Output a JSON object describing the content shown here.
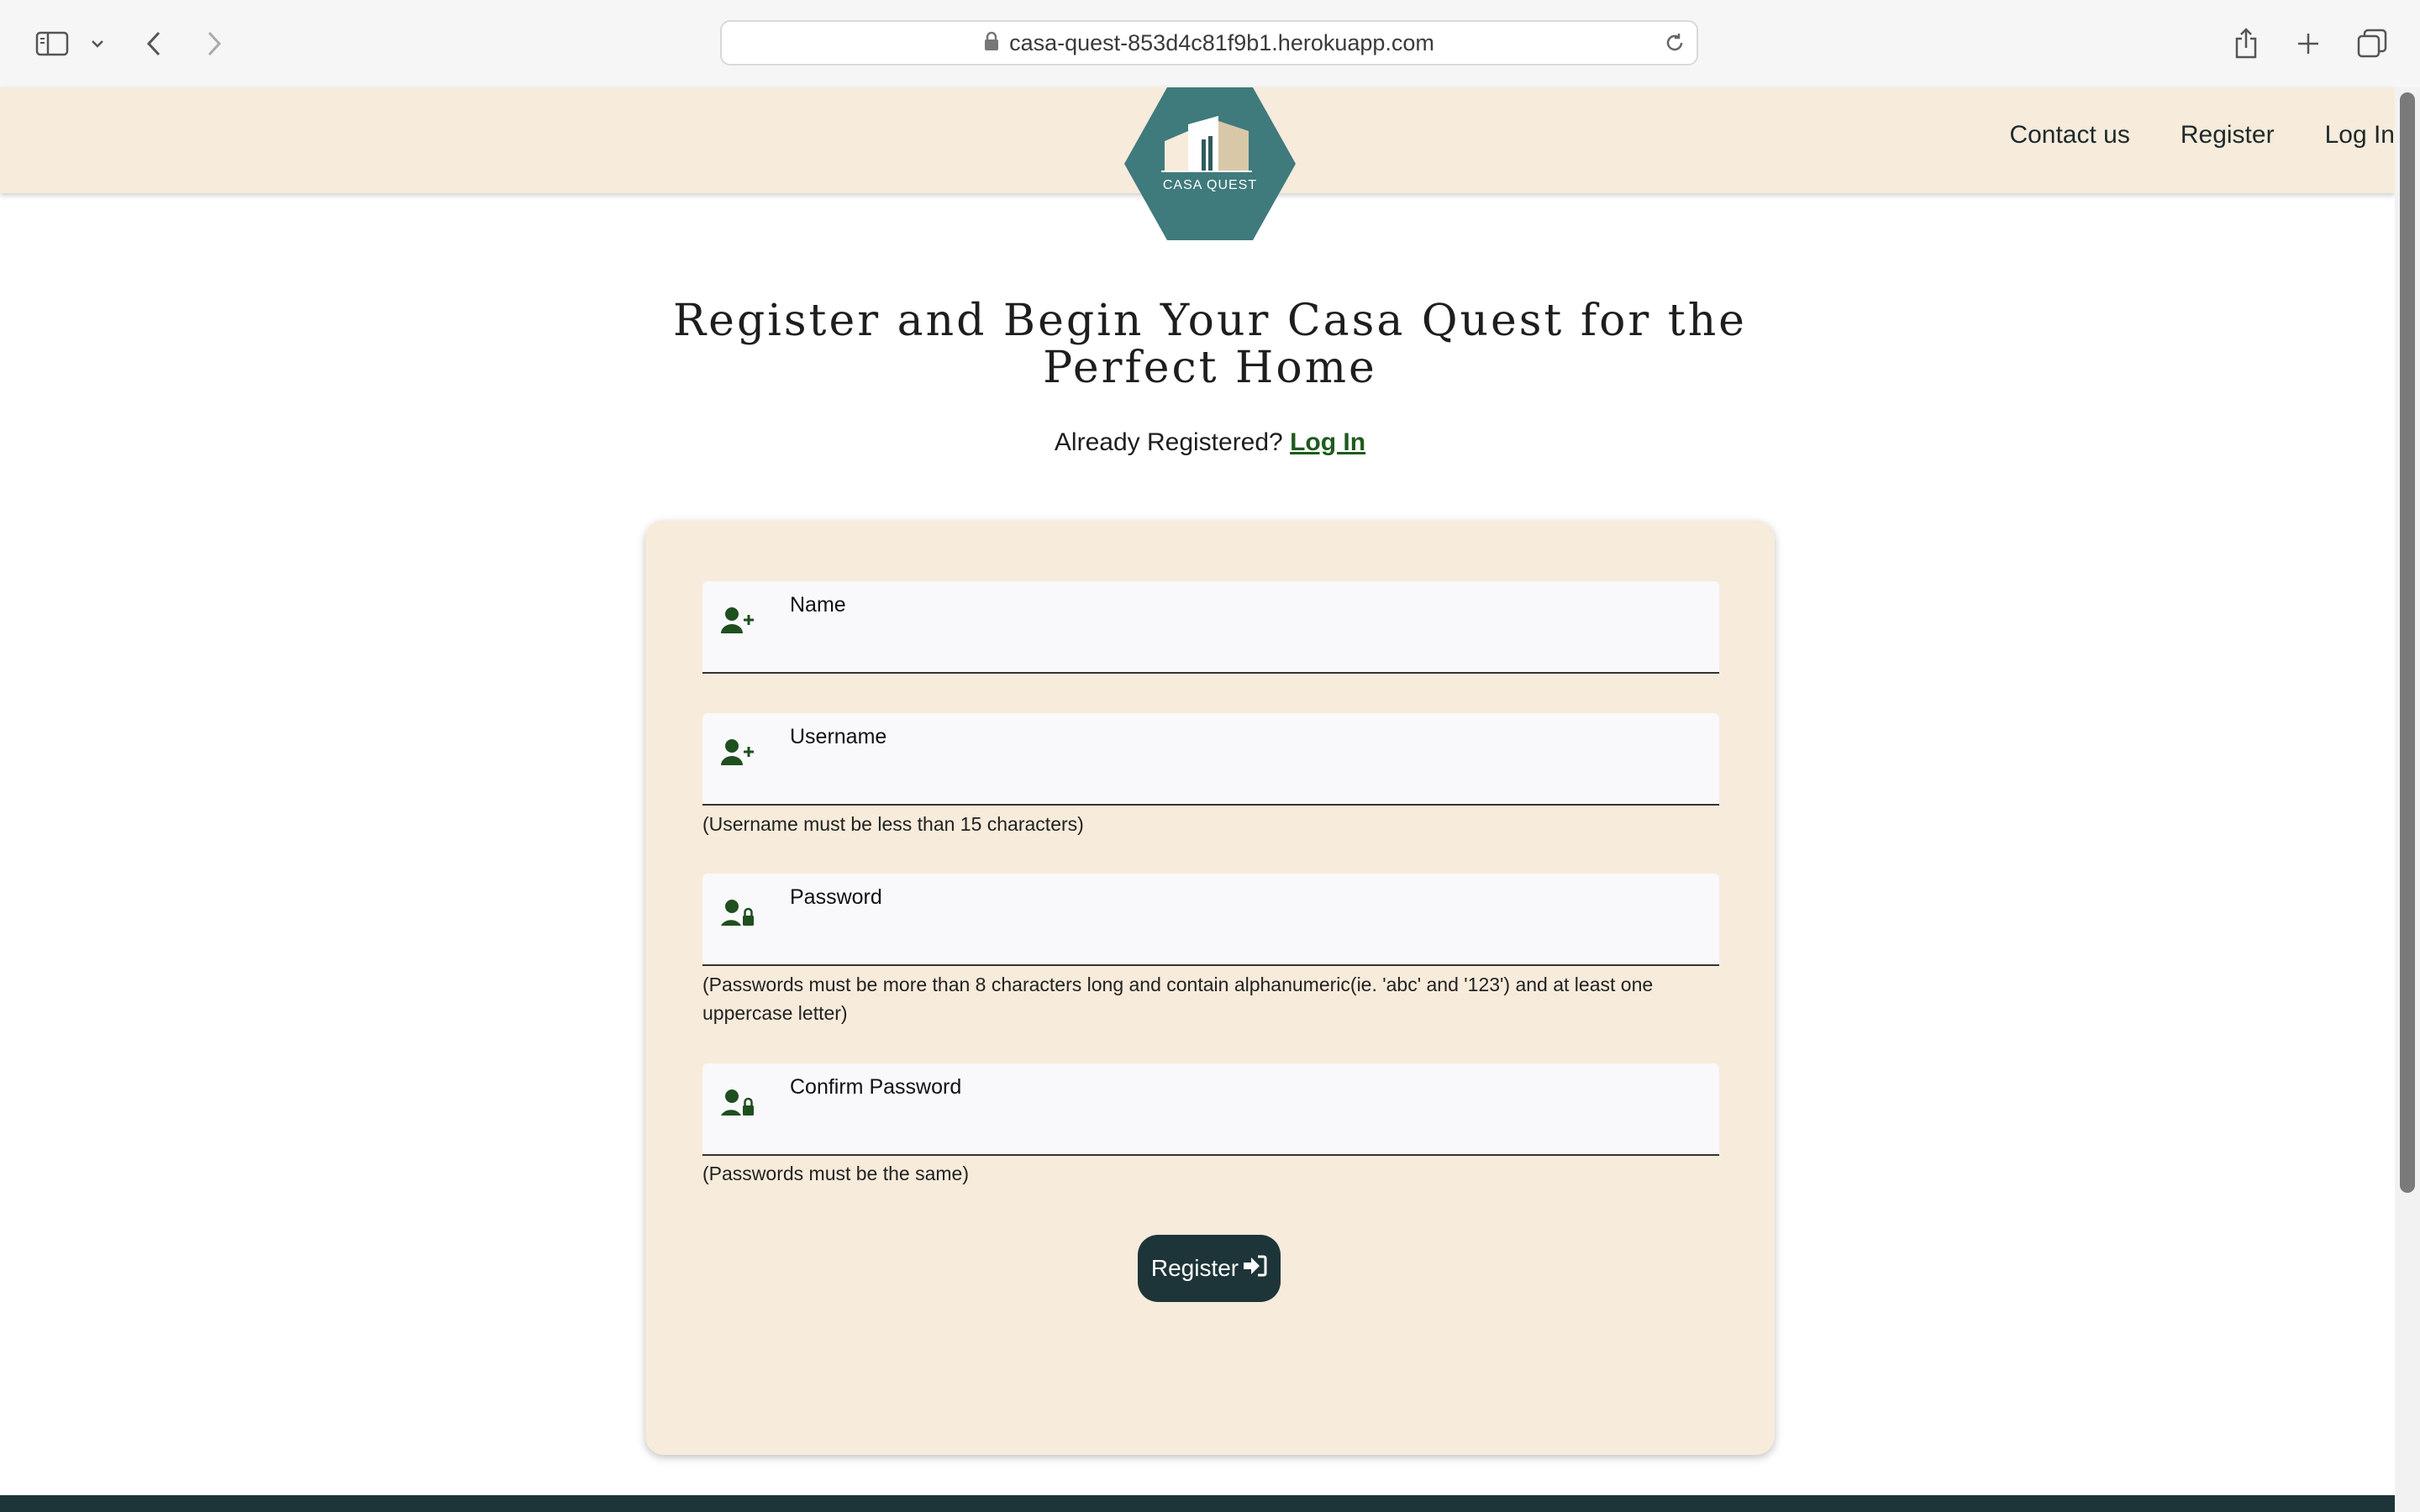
{
  "browser": {
    "url": "casa-quest-853d4c81f9b1.herokuapp.com"
  },
  "header": {
    "logo_text": "CASA QUEST",
    "nav": [
      "Contact us",
      "Register",
      "Log In"
    ]
  },
  "main": {
    "title": "Register and Begin Your Casa Quest for the Perfect Home",
    "already_text": "Already Registered?",
    "login_link": "Log In"
  },
  "form": {
    "name_label": "Name",
    "username_label": "Username",
    "username_help": "(Username must be less than 15 characters)",
    "password_label": "Password",
    "password_help": "(Passwords must be more than 8 characters long and contain alphanumeric(ie. 'abc' and '123') and at least one uppercase letter)",
    "confirm_label": "Confirm Password",
    "confirm_help": "(Passwords must be the same)",
    "submit_label": "Register"
  },
  "colors": {
    "header_bg": "#f7ebdb",
    "accent_dark": "#1d3538",
    "link_green": "#1f5a1f",
    "logo_teal": "#3f7a7d"
  },
  "icons": [
    "sidebar-icon",
    "chevron-down-icon",
    "back-arrow-icon",
    "forward-arrow-icon",
    "lock-icon",
    "reload-icon",
    "share-icon",
    "new-tab-icon",
    "tabs-overview-icon",
    "user-plus-icon",
    "user-lock-icon",
    "sign-in-icon"
  ]
}
